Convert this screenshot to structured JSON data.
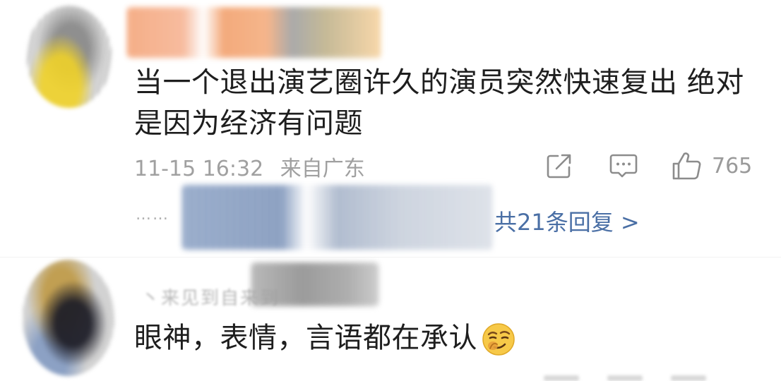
{
  "comments": [
    {
      "text": "当一个退出演艺圈许久的演员突然快速复出 绝对是因为经济有问题",
      "time": "11-15 16:32",
      "source": "来自广东",
      "likes": "765",
      "replies_more": "共21条回复 >",
      "dots": "……",
      "icons": [
        "share-icon",
        "comment-icon",
        "thumbs-up-icon"
      ]
    },
    {
      "text": "眼神，表情，言语都在承认",
      "faded_prefix": "丶来见到自来到",
      "emoji": "smirking-face-icon"
    }
  ],
  "colors": {
    "text": "#1e1e1e",
    "meta": "#a0a0a0",
    "link": "#4a6fa5"
  }
}
